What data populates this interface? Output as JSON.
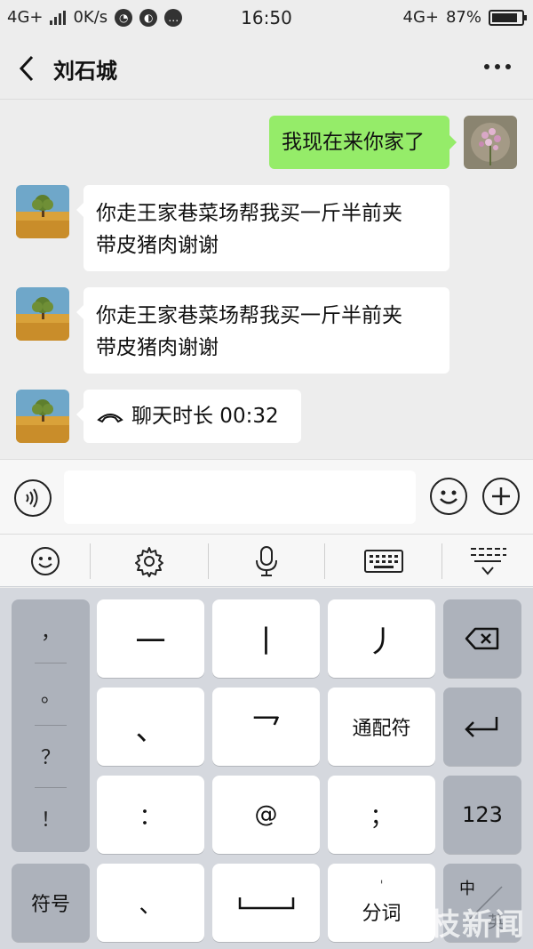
{
  "status_bar": {
    "network_left": "4G+",
    "speed": "0K/s",
    "time": "16:50",
    "network_right": "4G+",
    "battery_percent": "87%",
    "battery_level": 0.87
  },
  "header": {
    "title": "刘石城"
  },
  "messages": [
    {
      "side": "out",
      "text": "我现在来你家了"
    },
    {
      "side": "in",
      "line1": "你走王家巷菜场帮我买一斤半前夹",
      "line2": "带皮猪肉谢谢"
    },
    {
      "side": "in",
      "line1": "你走王家巷菜场帮我买一斤半前夹",
      "line2": "带皮猪肉谢谢"
    },
    {
      "side": "in",
      "text": "聊天时长 00:32"
    }
  ],
  "input_bar": {
    "value": ""
  },
  "keyboard": {
    "left_column": [
      "，",
      "。",
      "？",
      "！"
    ],
    "rows": [
      [
        "一",
        "丨",
        "丿"
      ],
      [
        "、",
        "乛",
        "通配符"
      ],
      [
        "：",
        "@",
        "；"
      ]
    ],
    "right_column": {
      "enter": "↵",
      "num": "123"
    },
    "bottom": {
      "symbols": "符号",
      "dun": "、",
      "segment_mark": "'",
      "segment": "分词",
      "lang_top": "中",
      "lang_bottom": "英"
    }
  },
  "watermark": "荔枝新闻",
  "colors": {
    "out_bubble": "#95ec69",
    "in_bubble": "#ffffff",
    "background": "#ededed",
    "keyboard_bg": "#d5d8de"
  }
}
